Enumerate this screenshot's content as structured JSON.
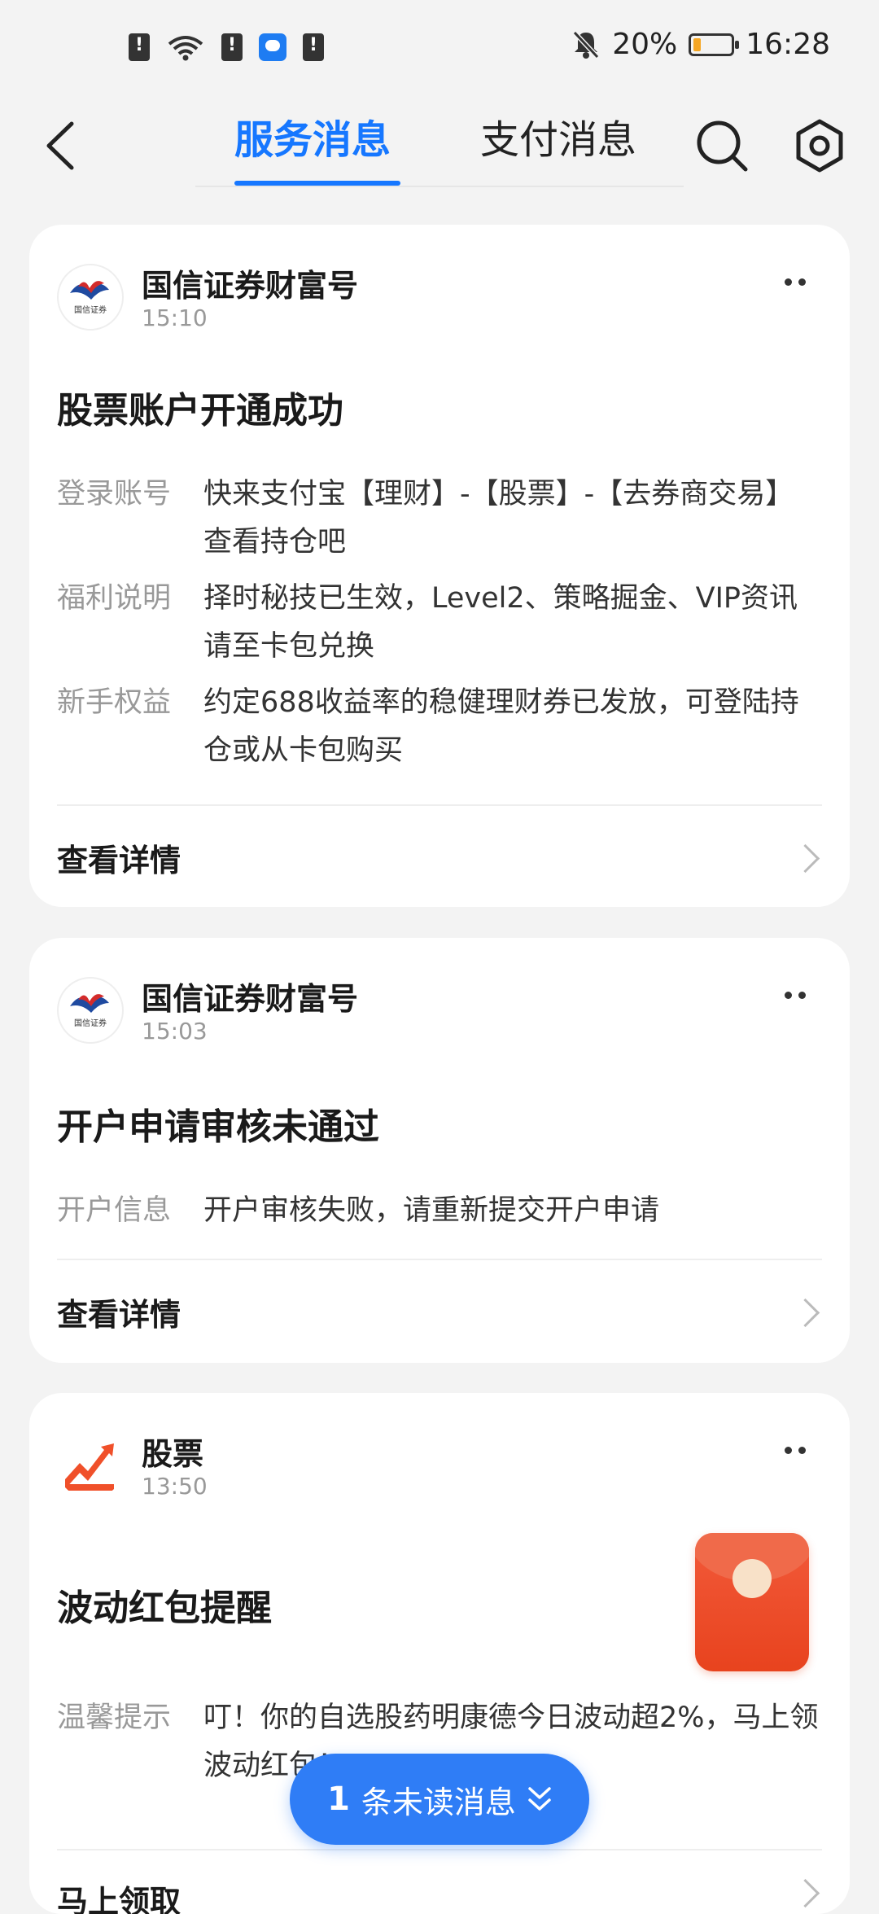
{
  "status_bar": {
    "battery_percent": "20%",
    "battery_level": 0.2,
    "time": "16:28",
    "battery_color": "#f5a623"
  },
  "header": {
    "tabs": [
      {
        "label": "服务消息",
        "active": true
      },
      {
        "label": "支付消息",
        "active": false
      }
    ],
    "accent_color": "#1677ff"
  },
  "cards": [
    {
      "account_name": "国信证券财富号",
      "time": "15:10",
      "title": "股票账户开通成功",
      "rows": [
        {
          "label": "登录账号",
          "value": "快来支付宝【理财】-【股票】-【去券商交易】查看持仓吧"
        },
        {
          "label": "福利说明",
          "value": "择时秘技已生效，Level2、策略掘金、VIP资讯请至卡包兑换"
        },
        {
          "label": "新手权益",
          "value": "约定688收益率的稳健理财券已发放，可登陆持仓或从卡包购买"
        }
      ],
      "action": "查看详情",
      "avatar_text": "国信证券"
    },
    {
      "account_name": "国信证券财富号",
      "time": "15:03",
      "title": "开户申请审核未通过",
      "rows": [
        {
          "label": "开户信息",
          "value": "开户审核失败，请重新提交开户申请"
        }
      ],
      "action": "查看详情",
      "avatar_text": "国信证券"
    },
    {
      "account_name": "股票",
      "time": "13:50",
      "title": "波动红包提醒",
      "rows": [
        {
          "label": "温馨提示",
          "value": "叮！你的自选股药明康德今日波动超2%，马上领波动红包！"
        }
      ],
      "action": "马上领取"
    }
  ],
  "unread_button": {
    "count": "1",
    "label": "条未读消息"
  }
}
